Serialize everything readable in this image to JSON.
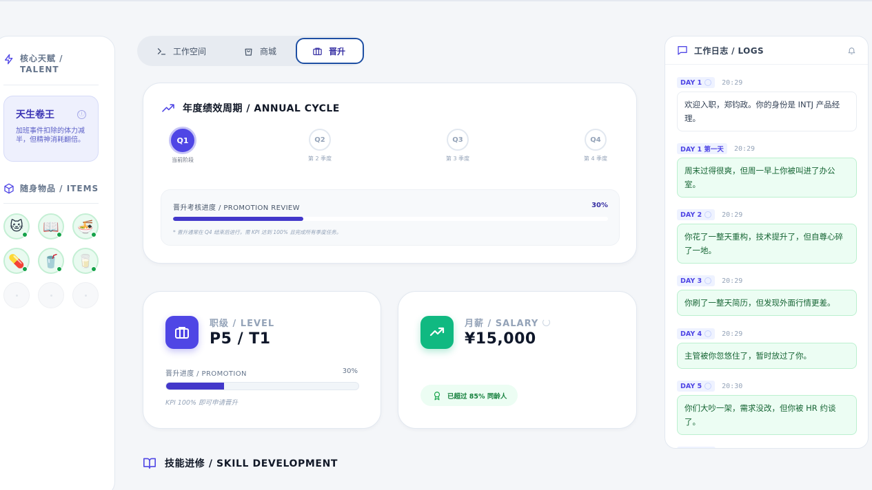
{
  "sidebar": {
    "talent_heading_line1": "核心天赋 /",
    "talent_heading_line2": "TALENT",
    "talent": {
      "name": "天生卷王",
      "description": "加班事件扣除的体力减半，但精神消耗翻倍。",
      "info_icon": "ⓘ"
    },
    "items_heading": "随身物品 / ITEMS",
    "items": [
      {
        "icon": "🐱",
        "name": "cat-icon"
      },
      {
        "icon": "📖",
        "name": "book-icon"
      },
      {
        "icon": "🍜",
        "name": "noodle-bowl-icon"
      },
      {
        "icon": "💊",
        "name": "pill-icon"
      },
      {
        "icon": "🥤",
        "name": "drink-cup-icon"
      },
      {
        "icon": "🥛",
        "name": "milk-icon"
      }
    ],
    "empty_slots": 3
  },
  "tabs": {
    "workspace": "工作空间",
    "shop": "商城",
    "promotion": "晋升",
    "active": "promotion"
  },
  "cycle": {
    "title": "年度绩效周期 / ANNUAL CYCLE",
    "quarters": [
      {
        "code": "Q1",
        "label": "当前阶段",
        "active": true
      },
      {
        "code": "Q2",
        "label": "第 2 季度",
        "active": false
      },
      {
        "code": "Q3",
        "label": "第 3 季度",
        "active": false
      },
      {
        "code": "Q4",
        "label": "第 4 季度",
        "active": false
      }
    ],
    "review": {
      "title": "晋升考核进度 / PROMOTION REVIEW",
      "percent_text": "30%",
      "progress": 0.3,
      "note": "* 晋升通常在 Q4 结束后进行，需 KPI 达到 100% 且完成所有季度任务。"
    }
  },
  "level": {
    "label": "职级 / LEVEL",
    "value": "P5 / T1",
    "progress_title": "晋升进度 / PROMOTION",
    "progress_text": "30%",
    "progress": 0.3,
    "note": "KPI 100% 即可申请晋升"
  },
  "salary": {
    "label": "月薪 / SALARY",
    "value": "¥15,000",
    "badge": "已超过 85% 同龄人"
  },
  "skill": {
    "title": "技能进修 / SKILL DEVELOPMENT"
  },
  "logs": {
    "title": "工作日志 / LOGS",
    "entries": [
      {
        "day": "DAY 1",
        "time": "20:29",
        "text": "欢迎入职，郑钧政。你的身份是 INTJ 产品经理。",
        "style": "neutral",
        "spinner": true
      },
      {
        "day": "DAY 1 第一天",
        "time": "20:29",
        "text": "周末过得很爽，但周一早上你被叫进了办公室。",
        "style": "green",
        "spinner": false
      },
      {
        "day": "DAY 2",
        "time": "20:29",
        "text": "你花了一整天重构，技术提升了，但自尊心碎了一地。",
        "style": "green",
        "spinner": true
      },
      {
        "day": "DAY 3",
        "time": "20:29",
        "text": "你刷了一整天简历，但发现外面行情更差。",
        "style": "green",
        "spinner": true
      },
      {
        "day": "DAY 4",
        "time": "20:29",
        "text": "主管被你忽悠住了，暂时放过了你。",
        "style": "green",
        "spinner": true
      },
      {
        "day": "DAY 5",
        "time": "20:30",
        "text": "你们大吵一架，需求没改，但你被 HR 约谈了。",
        "style": "green",
        "spinner": true
      }
    ]
  },
  "colors": {
    "accent": "#4f46e5",
    "success": "#10b981",
    "background": "#f4f6f9"
  }
}
